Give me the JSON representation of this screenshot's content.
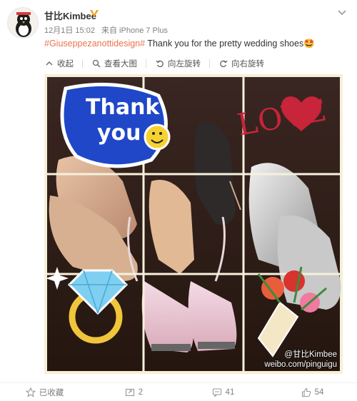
{
  "post": {
    "username": "甘比Kimbee",
    "meta": {
      "date": "12月1日 15:02",
      "source": "来自 iPhone 7 Plus"
    },
    "hashtag": "#Giuseppezanottidesign#",
    "text": " Thank you for the pretty wedding shoes",
    "emoji": "🤩"
  },
  "toolbar": {
    "collapse": "收起",
    "view_large": "查看大图",
    "rotate_left": "向左旋转",
    "rotate_right": "向右旋转"
  },
  "photo": {
    "sticker_thank": "Thank",
    "sticker_you": "you",
    "sticker_love": "LOVE",
    "watermark_handle": "@甘比Kimbee",
    "watermark_url": "weibo.com/pinguigu"
  },
  "actions": {
    "favorite": "已收藏",
    "repost_count": "2",
    "comment_count": "41",
    "like_count": "54"
  },
  "colors": {
    "hashtag": "#eb7350",
    "sticker_blue": "#1f47c8",
    "love_red": "#c8243a",
    "muted": "#808080"
  }
}
